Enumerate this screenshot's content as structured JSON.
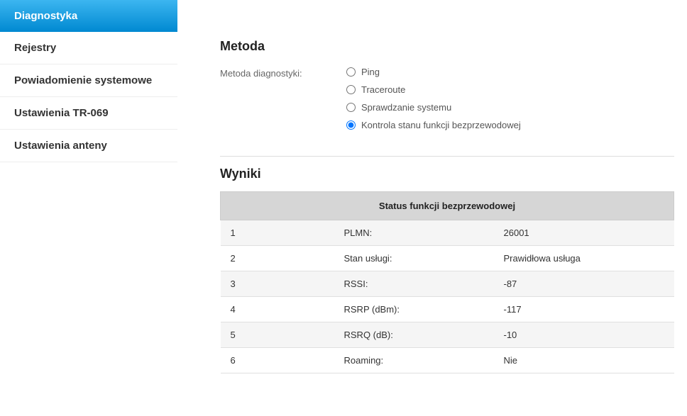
{
  "sidebar": {
    "items": [
      {
        "label": "Diagnostyka",
        "active": true
      },
      {
        "label": "Rejestry",
        "active": false
      },
      {
        "label": "Powiadomienie systemowe",
        "active": false
      },
      {
        "label": "Ustawienia TR-069",
        "active": false
      },
      {
        "label": "Ustawienia anteny",
        "active": false
      }
    ]
  },
  "method": {
    "title": "Metoda",
    "label": "Metoda diagnostyki:",
    "options": [
      {
        "label": "Ping",
        "selected": false
      },
      {
        "label": "Traceroute",
        "selected": false
      },
      {
        "label": "Sprawdzanie systemu",
        "selected": false
      },
      {
        "label": "Kontrola stanu funkcji bezprzewodowej",
        "selected": true
      }
    ]
  },
  "results": {
    "title": "Wyniki",
    "table_header": "Status funkcji bezprzewodowej",
    "rows": [
      {
        "idx": "1",
        "key": "PLMN:",
        "value": "26001"
      },
      {
        "idx": "2",
        "key": "Stan usługi:",
        "value": "Prawidłowa usługa"
      },
      {
        "idx": "3",
        "key": "RSSI:",
        "value": "-87"
      },
      {
        "idx": "4",
        "key": "RSRP (dBm):",
        "value": "-117"
      },
      {
        "idx": "5",
        "key": "RSRQ (dB):",
        "value": "-10"
      },
      {
        "idx": "6",
        "key": "Roaming:",
        "value": "Nie"
      }
    ]
  }
}
